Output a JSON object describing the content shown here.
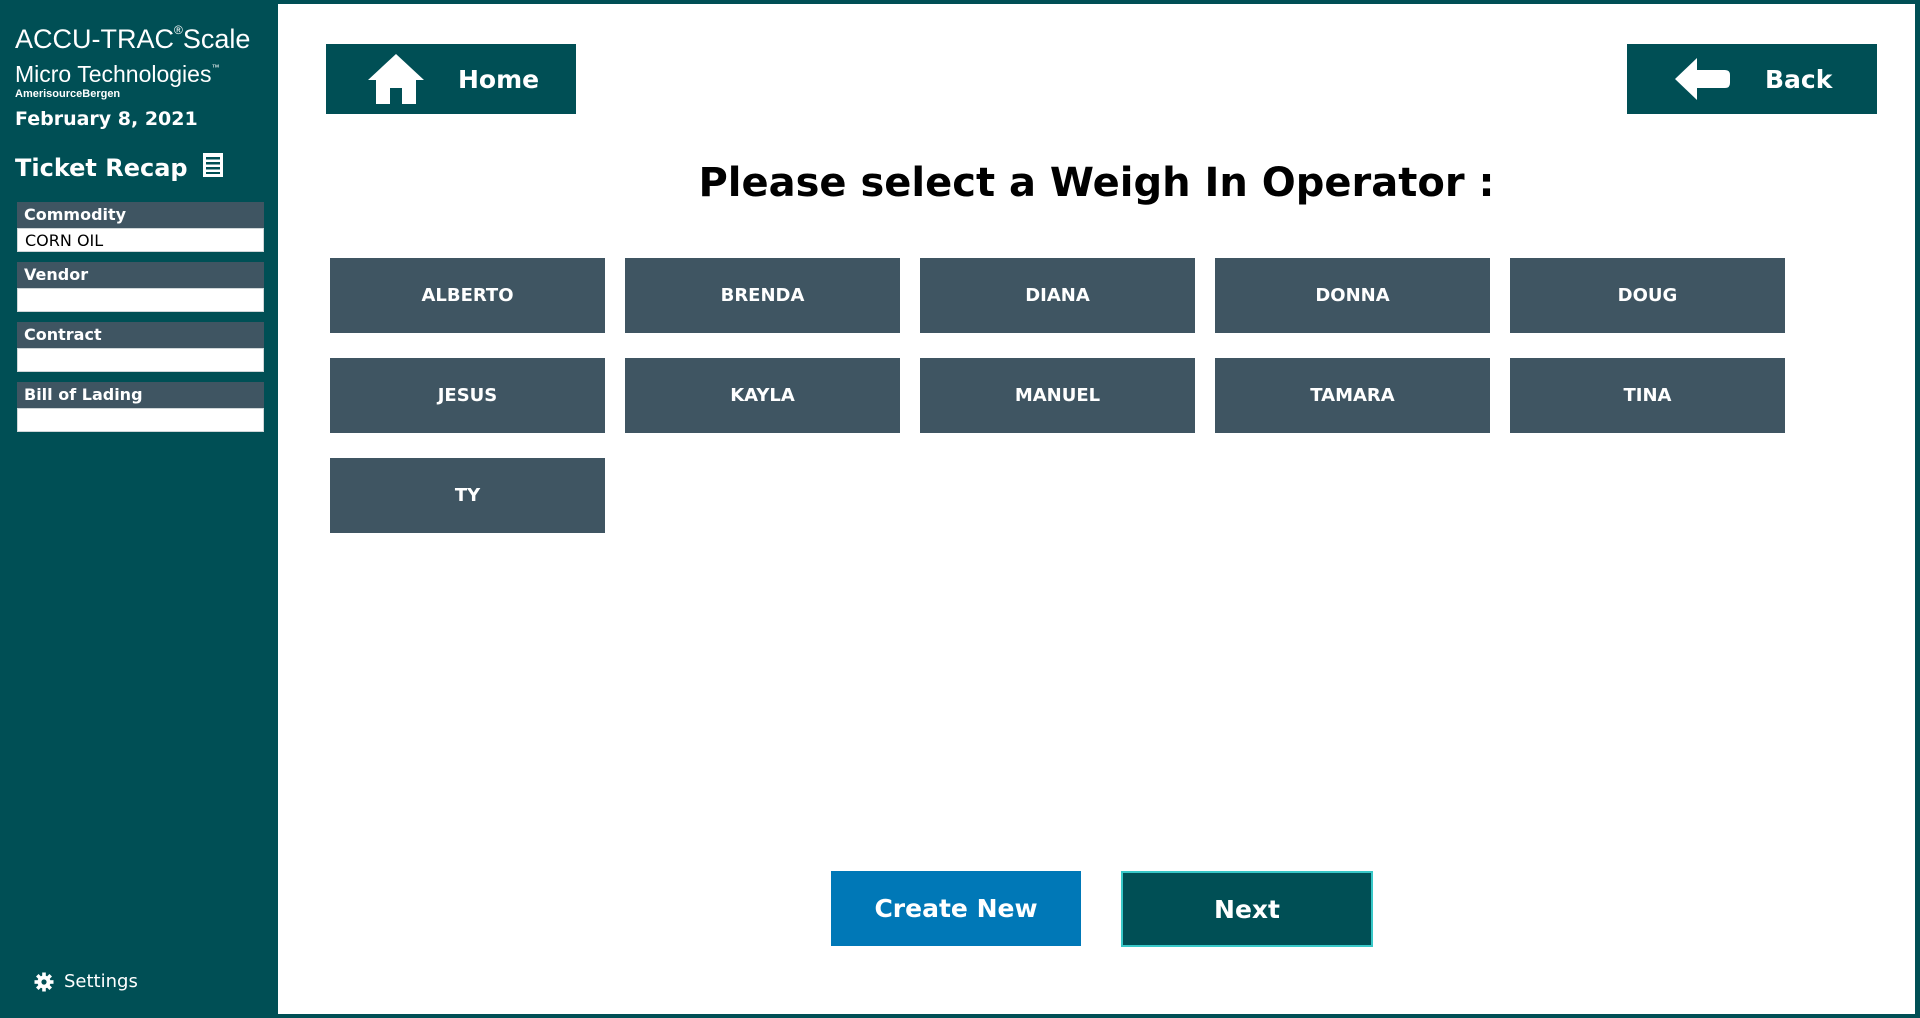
{
  "brand": {
    "line1": "ACCU-TRAC",
    "reg": "®",
    "line1_suffix": "Scale",
    "line2": "Micro Technologies",
    "tm": "™",
    "line3": "AmerisourceBergen"
  },
  "sidebar": {
    "date": "February 8, 2021",
    "recap_title": "Ticket Recap",
    "fields": [
      {
        "label": "Commodity",
        "value": "CORN OIL"
      },
      {
        "label": "Vendor",
        "value": ""
      },
      {
        "label": "Contract",
        "value": ""
      },
      {
        "label": "Bill of Lading",
        "value": ""
      }
    ],
    "settings_label": "Settings"
  },
  "nav": {
    "home_label": "Home",
    "back_label": "Back"
  },
  "prompt": "Please select a Weigh In Operator :",
  "operators": [
    "ALBERTO",
    "BRENDA",
    "DIANA",
    "DONNA",
    "DOUG",
    "JESUS",
    "KAYLA",
    "MANUEL",
    "TAMARA",
    "TINA",
    "TY"
  ],
  "actions": {
    "create_label": "Create New",
    "next_label": "Next"
  },
  "colors": {
    "primary": "#004f55",
    "operator_button": "#3f5562",
    "create_button": "#0078b7",
    "next_border": "#38c8c8"
  }
}
